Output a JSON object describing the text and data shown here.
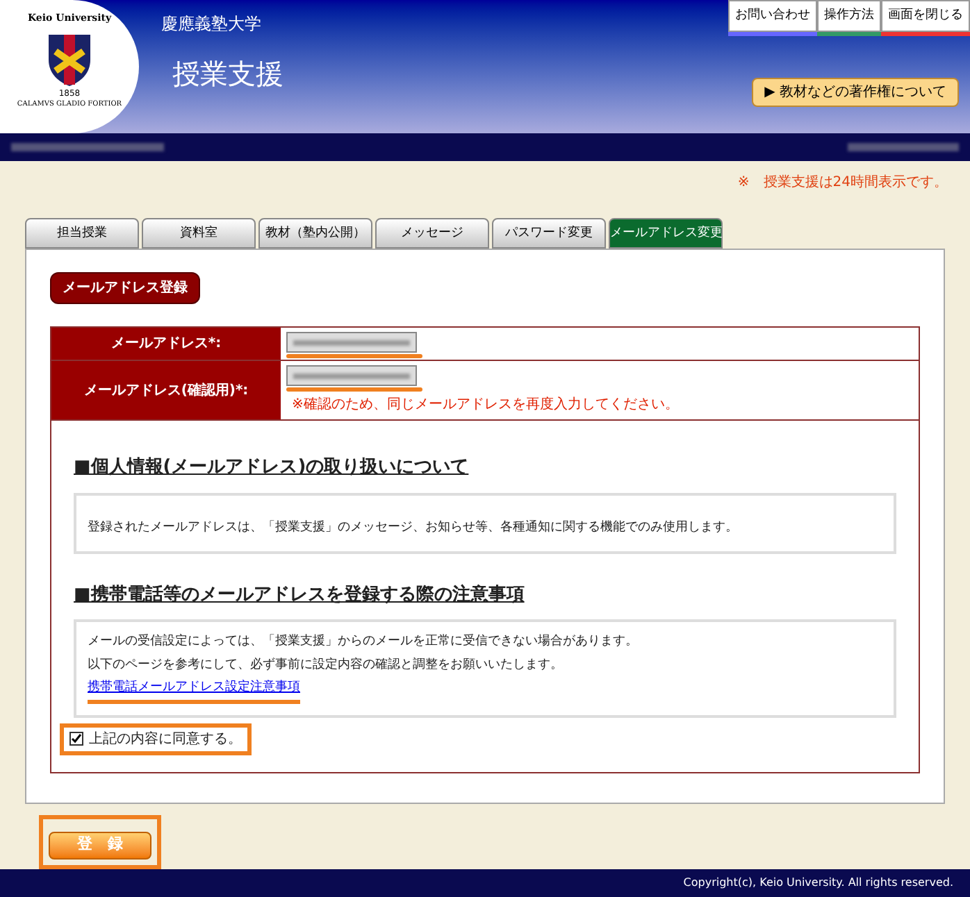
{
  "header": {
    "university": "Keio University",
    "univ_ja": "慶應義塾大学",
    "logo_year": "1858",
    "logo_motto": "CALAMVS GLADIO FORTIOR",
    "app_title": "授業支援",
    "top_buttons": [
      {
        "label": "お問い合わせ",
        "color": "#6666ff"
      },
      {
        "label": "操作方法",
        "color": "#339966"
      },
      {
        "label": "画面を閉じる",
        "color": "#ee3333"
      }
    ],
    "copyright_button": "▶ 教材などの著作権について"
  },
  "notice": "※　授業支援は24時間表示です。",
  "tabs": [
    {
      "label": "担当授業",
      "selected": false
    },
    {
      "label": "資料室",
      "selected": false
    },
    {
      "label": "教材（塾内公開）",
      "selected": false
    },
    {
      "label": "メッセージ",
      "selected": false
    },
    {
      "label": "パスワード変更",
      "selected": false
    },
    {
      "label": "メールアドレス変更",
      "selected": true
    }
  ],
  "section_badge": "メールアドレス登録",
  "form": [
    {
      "label": "メールアドレス*:"
    },
    {
      "label": "メールアドレス(確認用)*:",
      "note": "※確認のため、同じメールアドレスを再度入力してください。"
    }
  ],
  "privacy": {
    "heading": "■個人情報(メールアドレス)の取り扱いについて",
    "text": "登録されたメールアドレスは、「授業支援」のメッセージ、お知らせ等、各種通知に関する機能でのみ使用します。"
  },
  "mobile": {
    "heading": "■携帯電話等のメールアドレスを登録する際の注意事項",
    "lines": [
      "メールの受信設定によっては、「授業支援」からのメールを正常に受信できない場合があります。",
      "以下のページを参考にして、必ず事前に設定内容の確認と調整をお願いいたします。"
    ],
    "link": "携帯電話メールアドレス設定注意事項"
  },
  "agree": {
    "label": "上記の内容に同意する。",
    "checked": true
  },
  "submit": "登　録",
  "footer": "Copyright(c), Keio University. All rights reserved."
}
